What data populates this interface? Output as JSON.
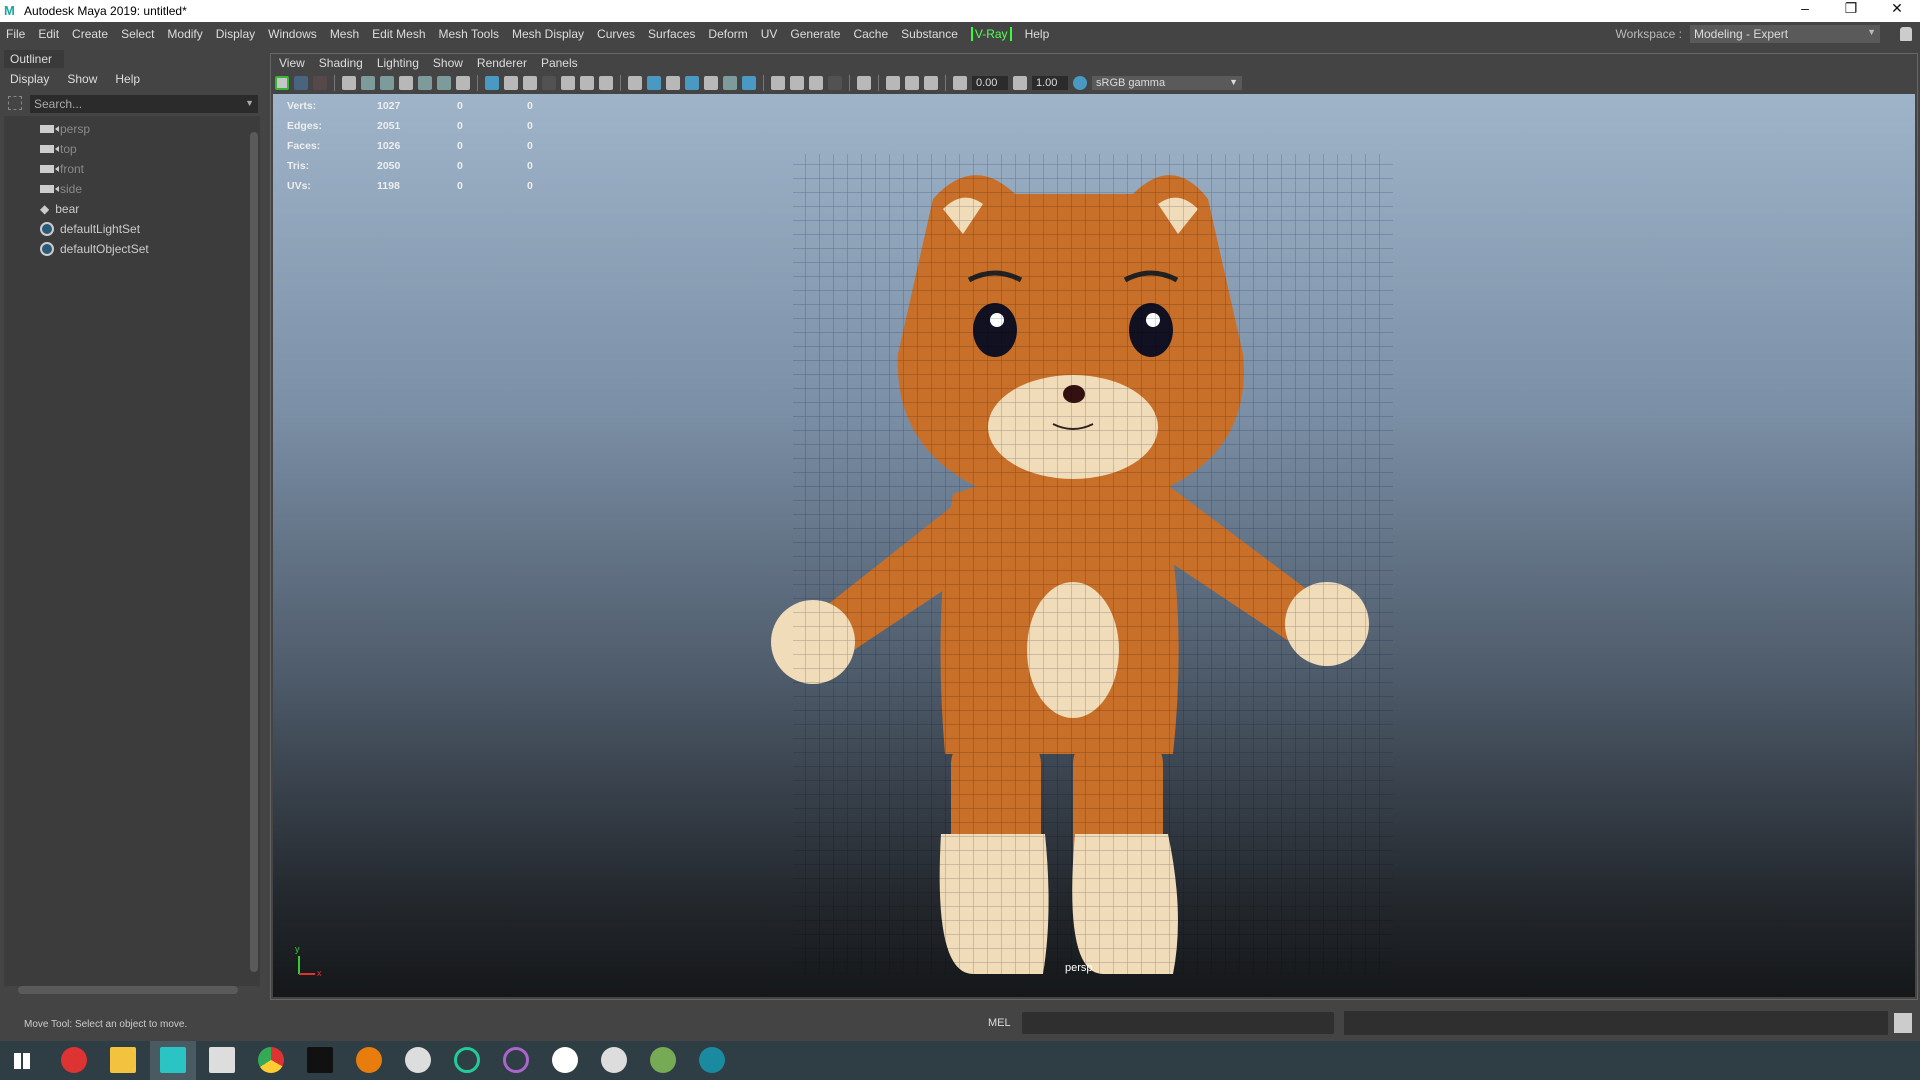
{
  "window": {
    "title": "Autodesk Maya 2019: untitled*",
    "logo": "M",
    "minimize": "–",
    "restore": "❐",
    "close": "✕"
  },
  "menubar": [
    "File",
    "Edit",
    "Create",
    "Select",
    "Modify",
    "Display",
    "Windows",
    "Mesh",
    "Edit Mesh",
    "Mesh Tools",
    "Mesh Display",
    "Curves",
    "Surfaces",
    "Deform",
    "UV",
    "Generate",
    "Cache",
    "Substance",
    "V-Ray",
    "Help"
  ],
  "workspace": {
    "label": "Workspace :",
    "value": "Modeling - Expert"
  },
  "outliner": {
    "tab": "Outliner",
    "menu": [
      "Display",
      "Show",
      "Help"
    ],
    "search_placeholder": "Search...",
    "items": [
      {
        "name": "persp",
        "icon": "camera-icon",
        "dim": true
      },
      {
        "name": "top",
        "icon": "camera-icon",
        "dim": true
      },
      {
        "name": "front",
        "icon": "camera-icon",
        "dim": true
      },
      {
        "name": "side",
        "icon": "camera-icon",
        "dim": true
      },
      {
        "name": "bear",
        "icon": "transform-icon",
        "dim": false
      },
      {
        "name": "defaultLightSet",
        "icon": "set-icon",
        "dim": false
      },
      {
        "name": "defaultObjectSet",
        "icon": "set-icon",
        "dim": false
      }
    ]
  },
  "viewport": {
    "menu": [
      "View",
      "Shading",
      "Lighting",
      "Show",
      "Renderer",
      "Panels"
    ],
    "exposure": "0.00",
    "gamma": "1.00",
    "colorspace": "sRGB gamma",
    "camera": "persp",
    "hud": [
      [
        "Verts:",
        "1027",
        "0",
        "0"
      ],
      [
        "Edges:",
        "2051",
        "0",
        "0"
      ],
      [
        "Faces:",
        "1026",
        "0",
        "0"
      ],
      [
        "Tris:",
        "2050",
        "0",
        "0"
      ],
      [
        "UVs:",
        "1198",
        "0",
        "0"
      ]
    ],
    "axis": {
      "y": "y",
      "x": "x"
    }
  },
  "statusline": {
    "help": "Move Tool: Select an object to move.",
    "mel": "MEL"
  },
  "colors": {
    "bear_fur": "#c8702a",
    "bear_light": "#f0dcb8",
    "wire": "#1a1a6a"
  }
}
